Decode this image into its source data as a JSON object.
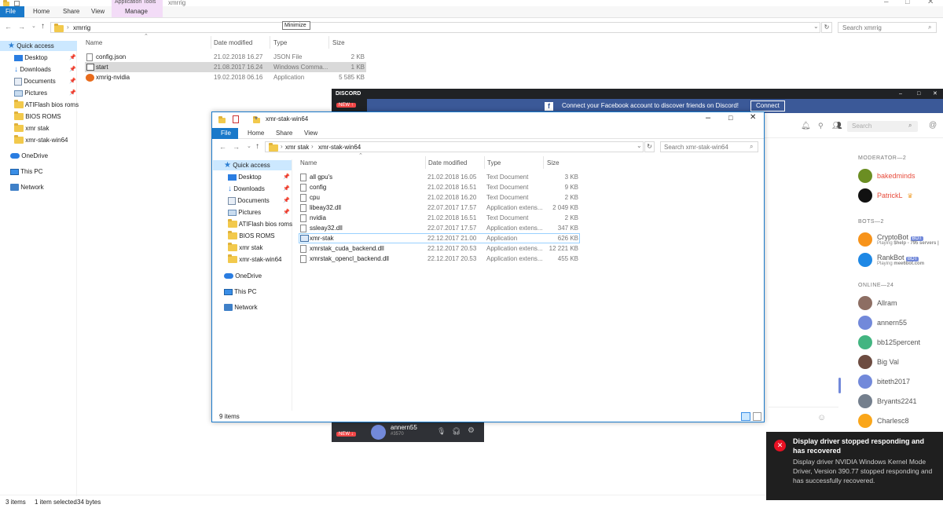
{
  "bg_window": {
    "title": "xmrrig",
    "context_tab": "Application Tools",
    "tabs": [
      "File",
      "Home",
      "Share",
      "View",
      "Manage"
    ],
    "tooltip": "Minimize",
    "path": "xmrrig",
    "search_placeholder": "Search xmrrig",
    "columns": [
      "Name",
      "Date modified",
      "Type",
      "Size"
    ],
    "files": [
      {
        "name": "config.json",
        "date": "21.02.2018 16.27",
        "type": "JSON File",
        "size": "2 KB",
        "icon": "doc-icon"
      },
      {
        "name": "start",
        "date": "21.08.2017 16.24",
        "type": "Windows Comma...",
        "size": "1 KB",
        "icon": "cmd-icon"
      },
      {
        "name": "xmrig-nvidia",
        "date": "19.02.2018 06.16",
        "type": "Application",
        "size": "5 585 KB",
        "icon": "app-icon"
      }
    ],
    "nav": {
      "quick_access": "Quick access",
      "items": [
        "Desktop",
        "Downloads",
        "Documents",
        "Pictures",
        "ATIFlash bios roms",
        "BIOS ROMS",
        "xmr stak",
        "xmr-stak-win64"
      ],
      "onedrive": "OneDrive",
      "thispc": "This PC",
      "network": "Network"
    },
    "status": {
      "count": "3 items",
      "selected": "1 item selected",
      "size": "34 bytes"
    }
  },
  "discord": {
    "logo": "DISCORD",
    "new_badge": "NEW",
    "fb_text": "Connect your Facebook account to discover friends on Discord!",
    "fb_button": "Connect",
    "search_placeholder": "Search",
    "sections": {
      "moderator": "MODERATOR—2",
      "bots": "BOTS—2",
      "online": "ONLINE—24"
    },
    "moderators": [
      {
        "name": "bakedminds",
        "color": "#e74c3c"
      },
      {
        "name": "PatrickL",
        "color": "#e74c3c"
      }
    ],
    "bots": [
      {
        "name": "CryptoBot",
        "tag": "BOT",
        "activity_prefix": "Playing",
        "activity": "$help - 795 servers |"
      },
      {
        "name": "RankBot",
        "tag": "BOT",
        "activity_prefix": "Playing",
        "activity": "mee6bot.com"
      }
    ],
    "online": [
      "Allram",
      "annern55",
      "bb125percent",
      "Big Val",
      "biteth2017",
      "Bryants2241",
      "Charlesc8"
    ],
    "user": {
      "name": "annern55",
      "tag": "#3570"
    }
  },
  "fg_window": {
    "title": "xmr-stak-win64",
    "tabs": [
      "File",
      "Home",
      "Share",
      "View"
    ],
    "path": [
      "xmr stak",
      "xmr-stak-win64"
    ],
    "search_placeholder": "Search xmr-stak-win64",
    "columns": [
      "Name",
      "Date modified",
      "Type",
      "Size"
    ],
    "files": [
      {
        "name": "all gpu's",
        "date": "21.02.2018 16.05",
        "type": "Text Document",
        "size": "3 KB"
      },
      {
        "name": "config",
        "date": "21.02.2018 16.51",
        "type": "Text Document",
        "size": "9 KB"
      },
      {
        "name": "cpu",
        "date": "21.02.2018 16.20",
        "type": "Text Document",
        "size": "2 KB"
      },
      {
        "name": "libeay32.dll",
        "date": "22.07.2017 17.57",
        "type": "Application extens...",
        "size": "2 049 KB"
      },
      {
        "name": "nvidia",
        "date": "21.02.2018 16.51",
        "type": "Text Document",
        "size": "2 KB"
      },
      {
        "name": "ssleay32.dll",
        "date": "22.07.2017 17.57",
        "type": "Application extens...",
        "size": "347 KB"
      },
      {
        "name": "xmr-stak",
        "date": "22.12.2017 21.00",
        "type": "Application",
        "size": "626 KB"
      },
      {
        "name": "xmrstak_cuda_backend.dll",
        "date": "22.12.2017 20.53",
        "type": "Application extens...",
        "size": "12 221 KB"
      },
      {
        "name": "xmrstak_opencl_backend.dll",
        "date": "22.12.2017 20.53",
        "type": "Application extens...",
        "size": "455 KB"
      }
    ],
    "nav": {
      "quick_access": "Quick access",
      "items": [
        "Desktop",
        "Downloads",
        "Documents",
        "Pictures",
        "ATIFlash bios roms",
        "BIOS ROMS",
        "xmr stak",
        "xmr-stak-win64"
      ],
      "onedrive": "OneDrive",
      "thispc": "This PC",
      "network": "Network"
    },
    "status": "9 items"
  },
  "toast": {
    "title": "Display driver stopped responding and has recovered",
    "body": "Display driver NVIDIA Windows Kernel Mode Driver, Version 390.77  stopped responding and has successfully recovered."
  }
}
